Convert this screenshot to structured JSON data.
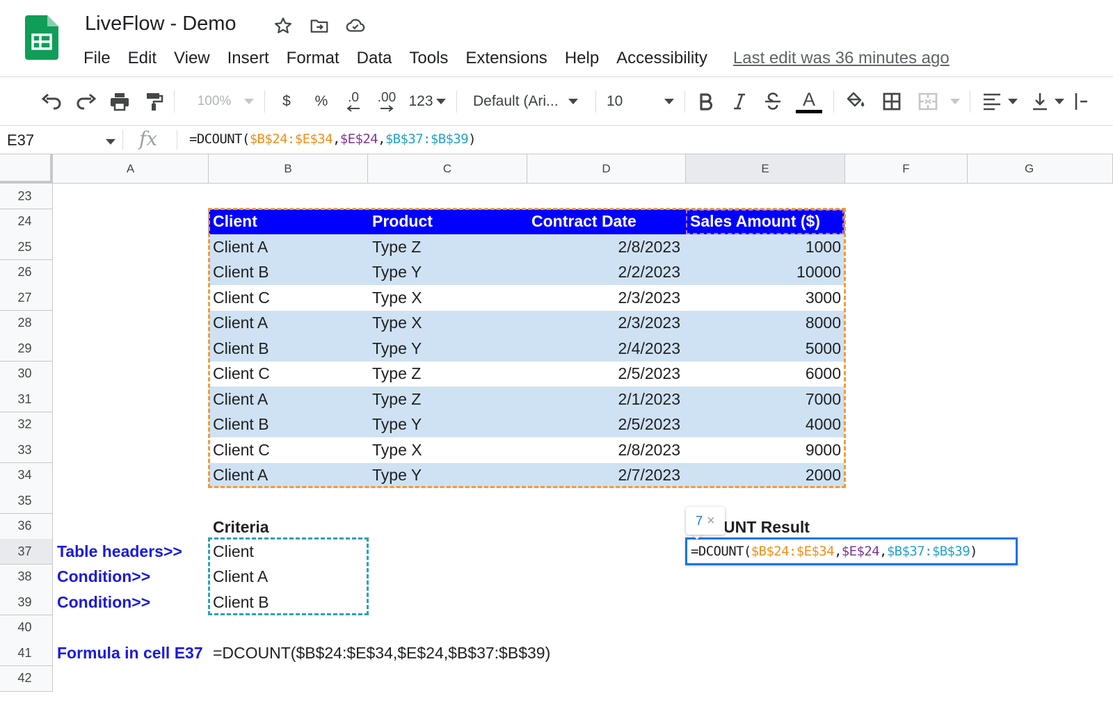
{
  "app": {
    "title": "LiveFlow - Demo",
    "menu": [
      "File",
      "Edit",
      "View",
      "Insert",
      "Format",
      "Data",
      "Tools",
      "Extensions",
      "Help",
      "Accessibility"
    ],
    "last_edit": "Last edit was 36 minutes ago"
  },
  "toolbar": {
    "zoom": "100%",
    "currency": "$",
    "percent": "%",
    "decrease_decimal": ".0",
    "increase_decimal": ".00",
    "number_format": "123",
    "font": "Default (Ari...",
    "font_size": "10",
    "text_color_letter": "A"
  },
  "formula_bar": {
    "name_box": "E37",
    "fx": "fx",
    "parts": [
      {
        "text": "=DCOUNT(",
        "color": "default"
      },
      {
        "text": "$B$24:$E$34",
        "color": "orange"
      },
      {
        "text": ",",
        "color": "default"
      },
      {
        "text": "$E$24",
        "color": "purple"
      },
      {
        "text": ",",
        "color": "default"
      },
      {
        "text": "$B$37:$B$39",
        "color": "blue"
      },
      {
        "text": ")",
        "color": "default"
      }
    ]
  },
  "grid": {
    "columns": [
      "A",
      "B",
      "C",
      "D",
      "E",
      "F",
      "G"
    ],
    "selected_column": "E",
    "rows": [
      23,
      24,
      25,
      26,
      27,
      28,
      29,
      30,
      31,
      32,
      33,
      34,
      35,
      36,
      37,
      38,
      39,
      40,
      41,
      42
    ],
    "selected_row": 37
  },
  "table": {
    "headers": [
      "Client",
      "Product",
      "Contract Date",
      "Sales Amount ($)"
    ],
    "rows": [
      [
        "Client A",
        "Type Z",
        "2/8/2023",
        "1000"
      ],
      [
        "Client B",
        "Type Y",
        "2/2/2023",
        "10000"
      ],
      [
        "Client C",
        "Type X",
        "2/3/2023",
        "3000"
      ],
      [
        "Client A",
        "Type X",
        "2/3/2023",
        "8000"
      ],
      [
        "Client B",
        "Type Y",
        "2/4/2023",
        "5000"
      ],
      [
        "Client C",
        "Type Z",
        "2/5/2023",
        "6000"
      ],
      [
        "Client A",
        "Type Z",
        "2/1/2023",
        "7000"
      ],
      [
        "Client B",
        "Type Y",
        "2/5/2023",
        "4000"
      ],
      [
        "Client C",
        "Type X",
        "2/8/2023",
        "9000"
      ],
      [
        "Client A",
        "Type Y",
        "2/7/2023",
        "2000"
      ]
    ]
  },
  "criteria": {
    "title": "Criteria",
    "values": [
      "Client",
      "Client A",
      "Client B"
    ]
  },
  "labels": {
    "table_headers": "Table headers>>",
    "condition1": "Condition>>",
    "condition2": "Condition>>",
    "formula_label": "Formula in cell E37",
    "formula_text": "=DCOUNT($B$24:$E$34,$E$24,$B$37:$B$39)"
  },
  "result": {
    "header_visible": "UNT Result",
    "tooltip_value": "7",
    "tooltip_close": "×"
  },
  "colors": {
    "header_fill": "#0000ff",
    "band_fill": "#cfe2f3",
    "label_blue": "#1a1adf",
    "ref_orange": "#f18f1a",
    "ref_purple": "#7e3794",
    "ref_blue": "#25a2c9",
    "selection_blue": "#1a73e8"
  }
}
